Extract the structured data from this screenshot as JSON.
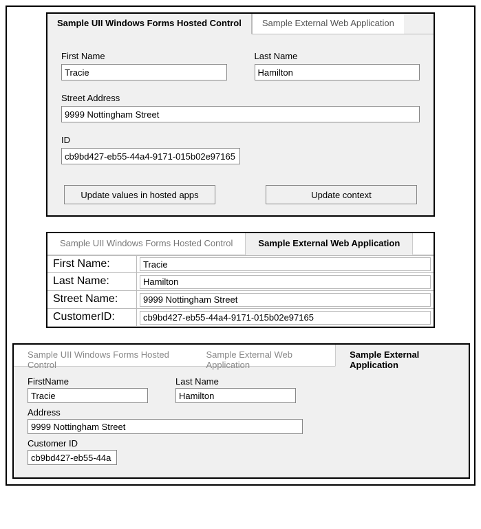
{
  "panel1": {
    "tabs": {
      "active": "Sample UII Windows Forms Hosted Control",
      "inactive": "Sample External Web Application"
    },
    "fields": {
      "firstNameLabel": "First Name",
      "firstName": "Tracie",
      "lastNameLabel": "Last Name",
      "lastName": "Hamilton",
      "streetLabel": "Street Address",
      "street": "9999 Nottingham Street",
      "idLabel": "ID",
      "id": "cb9bd427-eb55-44a4-9171-015b02e97165"
    },
    "buttons": {
      "update_hosted": "Update values in hosted apps",
      "update_context": "Update context"
    }
  },
  "panel2": {
    "tabs": {
      "inactive": "Sample UII Windows Forms Hosted Control",
      "active": "Sample External Web Application"
    },
    "rows": {
      "firstNameLabel": "First Name:",
      "firstName": "Tracie",
      "lastNameLabel": "Last Name:",
      "lastName": "Hamilton",
      "streetLabel": "Street Name:",
      "street": "9999 Nottingham Street",
      "custIdLabel": "CustomerID:",
      "custId": "cb9bd427-eb55-44a4-9171-015b02e97165"
    }
  },
  "panel3": {
    "tabs": {
      "t1": "Sample UII Windows Forms Hosted Control",
      "t2": "Sample External Web Application",
      "active": "Sample External Application"
    },
    "fields": {
      "firstNameLabel": "FirstName",
      "firstName": "Tracie",
      "lastNameLabel": "Last Name",
      "lastName": "Hamilton",
      "addressLabel": "Address",
      "address": "9999 Nottingham Street",
      "custIdLabel": "Customer ID",
      "custId": "cb9bd427-eb55-44a"
    }
  }
}
